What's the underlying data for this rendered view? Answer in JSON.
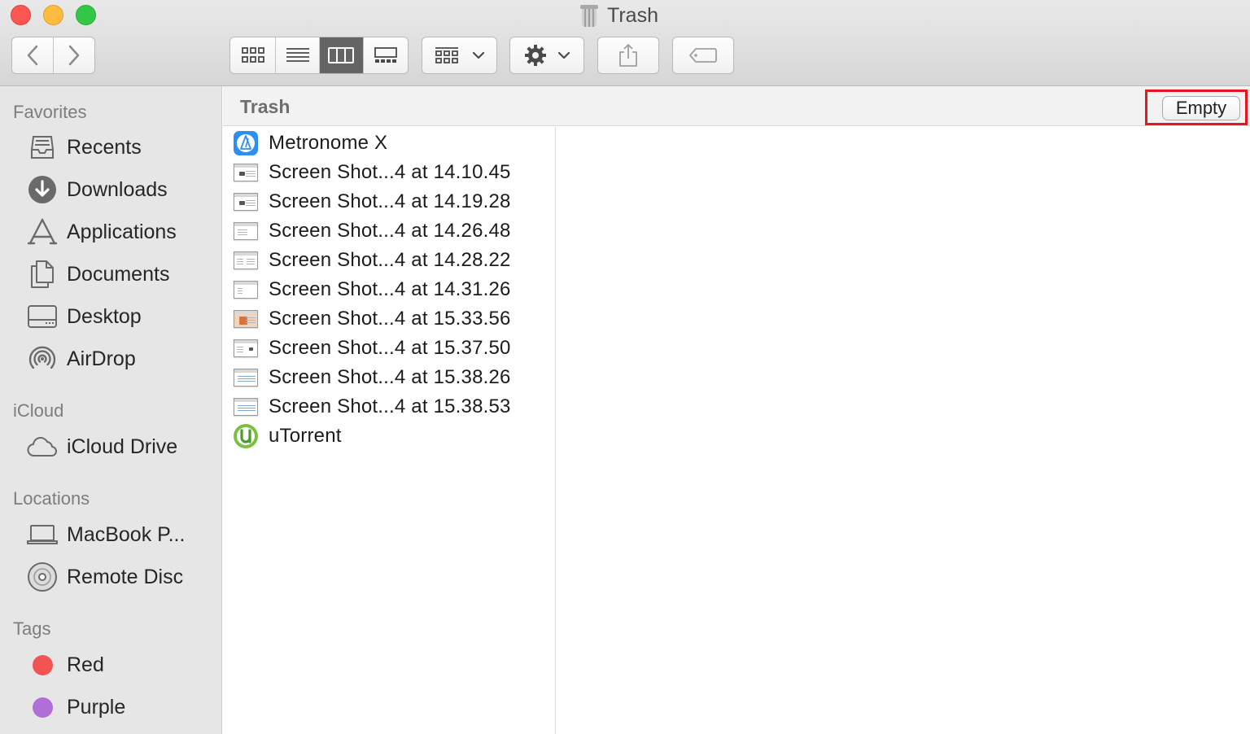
{
  "window": {
    "title": "Trash"
  },
  "sidebar": {
    "sections": {
      "favorites": "Favorites",
      "icloud": "iCloud",
      "locations": "Locations",
      "tags": "Tags"
    },
    "favorites": [
      {
        "label": "Recents",
        "icon": "recents-icon"
      },
      {
        "label": "Downloads",
        "icon": "downloads-icon"
      },
      {
        "label": "Applications",
        "icon": "applications-icon"
      },
      {
        "label": "Documents",
        "icon": "documents-icon"
      },
      {
        "label": "Desktop",
        "icon": "desktop-icon"
      },
      {
        "label": "AirDrop",
        "icon": "airdrop-icon"
      }
    ],
    "icloud": [
      {
        "label": "iCloud Drive",
        "icon": "cloud-icon"
      }
    ],
    "locations": [
      {
        "label": "MacBook P...",
        "icon": "laptop-icon"
      },
      {
        "label": "Remote Disc",
        "icon": "disc-icon"
      }
    ],
    "tags": [
      {
        "label": "Red",
        "color": "#f25353"
      },
      {
        "label": "Purple",
        "color": "#b26ed8"
      }
    ]
  },
  "pathbar": {
    "title": "Trash",
    "empty_label": "Empty"
  },
  "files": [
    {
      "name": "Metronome X",
      "icon": "metronome-app-icon"
    },
    {
      "name": "Screen Shot...4 at 14.10.45",
      "icon": "screenshot-file-icon"
    },
    {
      "name": "Screen Shot...4 at 14.19.28",
      "icon": "screenshot-file-icon"
    },
    {
      "name": "Screen Shot...4 at 14.26.48",
      "icon": "screenshot-file-icon"
    },
    {
      "name": "Screen Shot...4 at 14.28.22",
      "icon": "screenshot-file-icon"
    },
    {
      "name": "Screen Shot...4 at 14.31.26",
      "icon": "screenshot-file-icon"
    },
    {
      "name": "Screen Shot...4 at 15.33.56",
      "icon": "screenshot-file-icon"
    },
    {
      "name": "Screen Shot...4 at 15.37.50",
      "icon": "screenshot-file-icon"
    },
    {
      "name": "Screen Shot...4 at 15.38.26",
      "icon": "screenshot-file-icon"
    },
    {
      "name": "Screen Shot...4 at 15.38.53",
      "icon": "screenshot-file-icon"
    },
    {
      "name": "uTorrent",
      "icon": "utorrent-app-icon"
    }
  ],
  "colors": {
    "highlight_box": "#e8161c",
    "active_view": "#646464"
  }
}
